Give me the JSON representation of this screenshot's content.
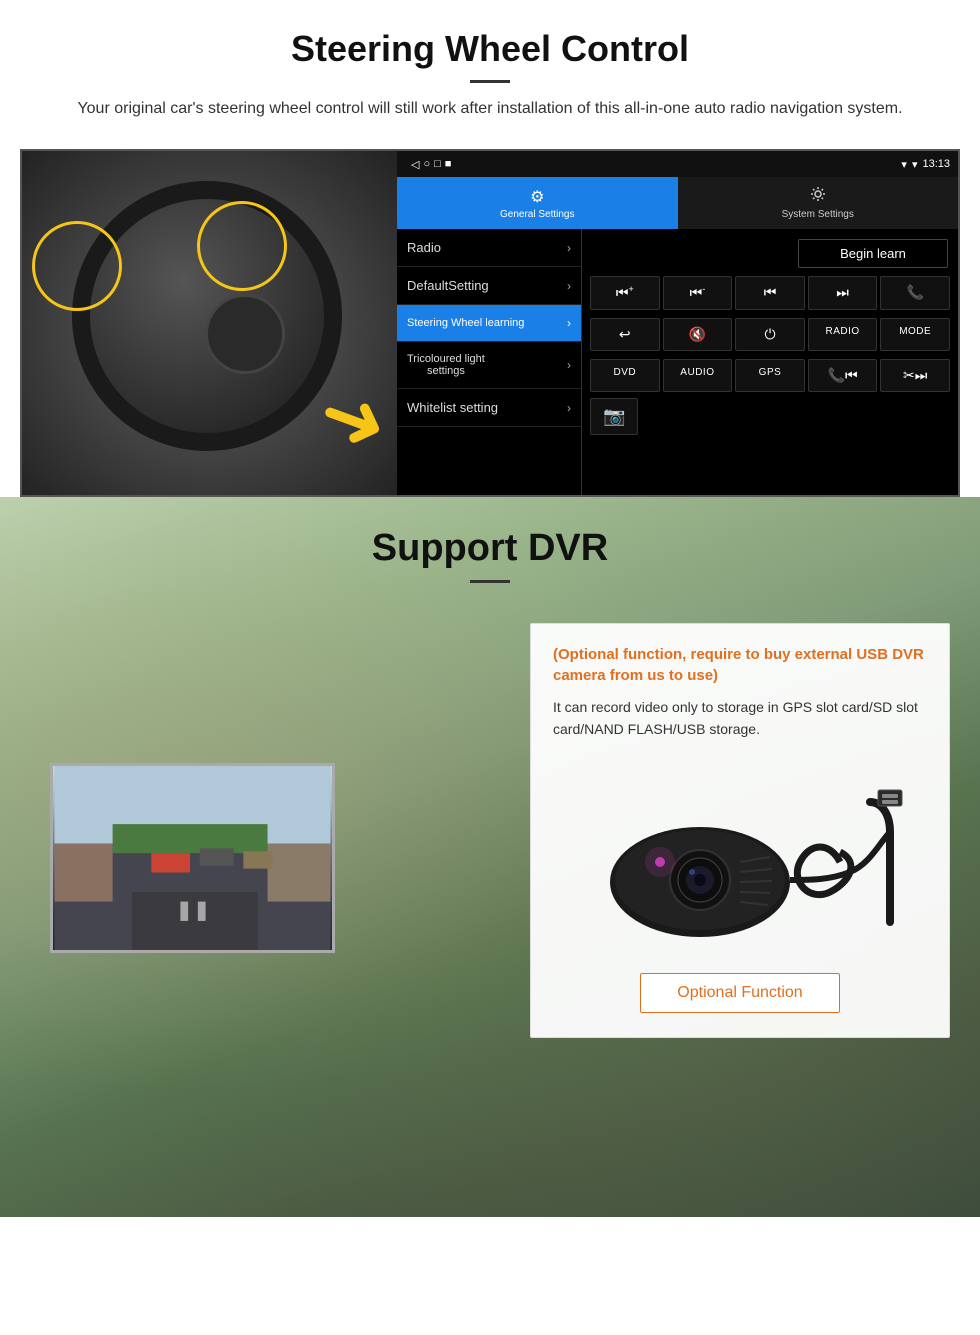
{
  "page": {
    "section1": {
      "title": "Steering Wheel Control",
      "description": "Your original car's steering wheel control will still work after installation of this all-in-one auto radio navigation system.",
      "statusbar": {
        "time": "13:13",
        "icons": [
          "◁",
          "○",
          "□",
          "■"
        ]
      },
      "tabs": [
        {
          "icon": "⚙",
          "label": "General Settings",
          "active": true
        },
        {
          "icon": "📶",
          "label": "System Settings",
          "active": false
        }
      ],
      "menu_items": [
        {
          "label": "Radio",
          "active": false
        },
        {
          "label": "DefaultSetting",
          "active": false
        },
        {
          "label": "Steering Wheel learning",
          "active": true
        },
        {
          "label": "Tricoloured light settings",
          "active": false
        },
        {
          "label": "Whitelist setting",
          "active": false
        }
      ],
      "begin_learn": "Begin learn",
      "ctrl_buttons_row1": [
        "⏮+",
        "⏮-",
        "⏮⏮",
        "⏭⏭",
        "📞"
      ],
      "ctrl_buttons_row2": [
        "↩",
        "🔇",
        "⏻",
        "RADIO",
        "MODE"
      ],
      "ctrl_buttons_row3": [
        "DVD",
        "AUDIO",
        "GPS",
        "📞⏮",
        "✂⏭"
      ],
      "ctrl_extra": [
        "📷"
      ]
    },
    "section2": {
      "title": "Support DVR",
      "optional_text": "(Optional function, require to buy external USB DVR camera from us to use)",
      "description": "It can record video only to storage in GPS slot card/SD slot card/NAND FLASH/USB storage.",
      "optional_function_btn": "Optional Function"
    }
  }
}
